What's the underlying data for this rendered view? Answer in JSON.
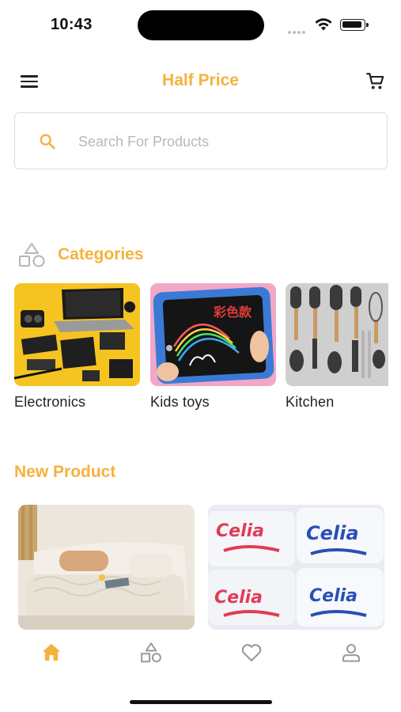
{
  "status_bar": {
    "time": "10:43"
  },
  "header": {
    "title": "Half Price",
    "menu_icon": "hamburger-menu-icon",
    "cart_icon": "shopping-cart-icon"
  },
  "search": {
    "placeholder": "Search For Products",
    "value": "",
    "icon": "search-icon"
  },
  "categories": {
    "title": "Categories",
    "icon": "shapes-icon",
    "items": [
      {
        "label": "Electronics"
      },
      {
        "label": "Kids toys"
      },
      {
        "label": "Kitchen"
      }
    ]
  },
  "new_product": {
    "title": "New Product",
    "items": [
      {
        "image": "sofa-cover-photo"
      },
      {
        "image": "celia-packaged-product-photo"
      }
    ]
  },
  "tabbar": {
    "tabs": [
      {
        "icon": "home-icon",
        "active": true
      },
      {
        "icon": "categories-icon",
        "active": false
      },
      {
        "icon": "heart-icon",
        "active": false
      },
      {
        "icon": "profile-icon",
        "active": false
      }
    ]
  },
  "colors": {
    "accent": "#f5b23c",
    "inactive_icon": "#9a9a9a",
    "text": "#222222"
  }
}
